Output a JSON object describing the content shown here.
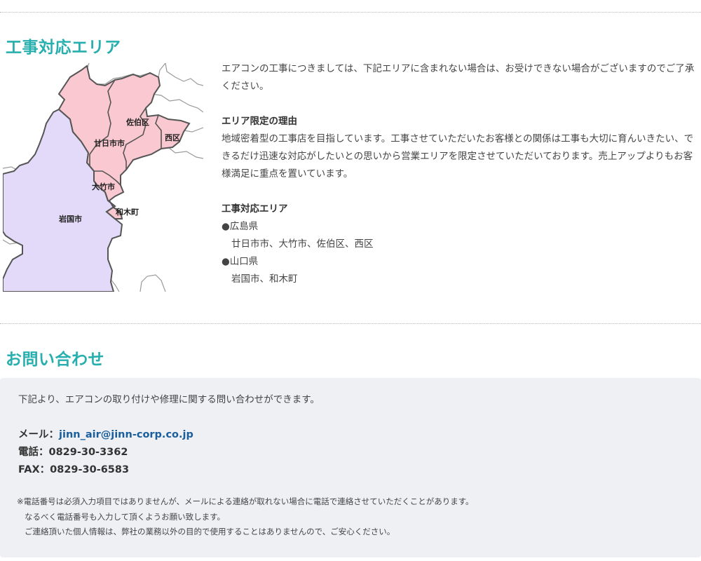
{
  "area": {
    "title": "工事対応エリア",
    "intro": "エアコンの工事につきましては、下記エリアに含まれない場合は、お受けできない場合がございますのでご了承ください。",
    "reason_heading": "エリア限定の理由",
    "reason_body": "地域密着型の工事店を目指しています。工事させていただいたお客様との関係は工事も大切に育んいきたい、できるだけ迅速な対応がしたいとの思いから営業エリアを限定させていただいております。売上アップよりもお客様満足に重点を置いています。",
    "list_heading": "工事対応エリア",
    "prefectures": [
      {
        "name": "●広島県",
        "cities": "廿日市市、大竹市、佐伯区、西区"
      },
      {
        "name": "●山口県",
        "cities": "岩国市、和木町"
      }
    ]
  },
  "map": {
    "labels": {
      "saeki": "佐伯区",
      "hatsukaichi": "廿日市市",
      "nishi": "西区",
      "otake": "大竹市",
      "iwakuni": "岩国市",
      "waki": "和木町"
    },
    "colors": {
      "hiroshima_fill": "#fac8d0",
      "yamaguchi_fill": "#e2daf8",
      "border": "#555555",
      "outline": "#999999"
    }
  },
  "contact": {
    "title": "お問い合わせ",
    "intro": "下記より、エアコンの取り付けや修理に関する問い合わせができます。",
    "mail_label": "メール：",
    "mail": "jinn_air@jinn-corp.co.jp",
    "phone": "電話：0829-30-3362",
    "fax": "FAX：0829-30-6583",
    "notes": [
      "※電話番号は必須入力項目ではありませんが、メールによる連絡が取れない場合に電話で連絡させていただくことがあります。",
      "なるべく電話番号も入力して頂くようお願い致します。",
      "ご連絡頂いた個人情報は、弊社の業務以外の目的で使用することはありませんので、ご安心ください。"
    ]
  },
  "theme": {
    "accent": "#27aeae",
    "link": "#1a5f9c",
    "box_bg": "#eef0f4"
  }
}
